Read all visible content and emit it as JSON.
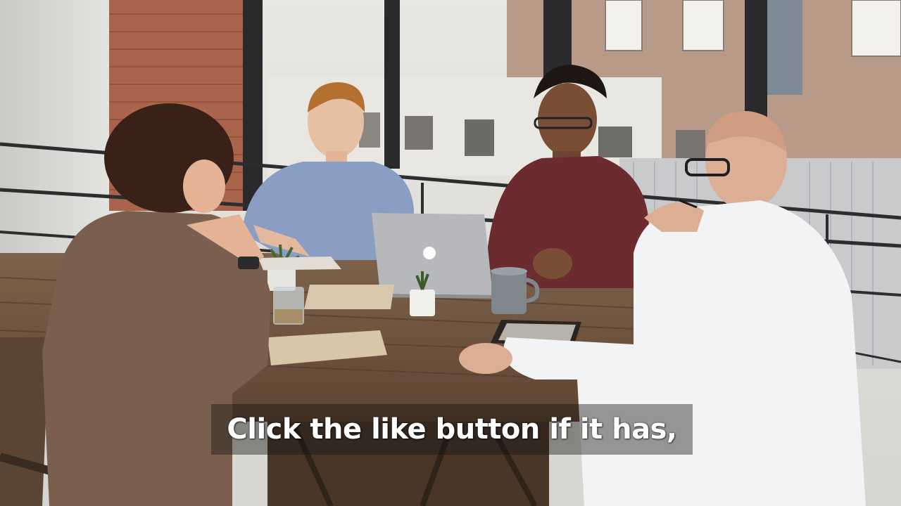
{
  "video": {
    "caption": "Click the like button if it has,"
  },
  "scene": {
    "subject": "meeting-photo",
    "laptop_logo": "apple-logo-icon"
  }
}
